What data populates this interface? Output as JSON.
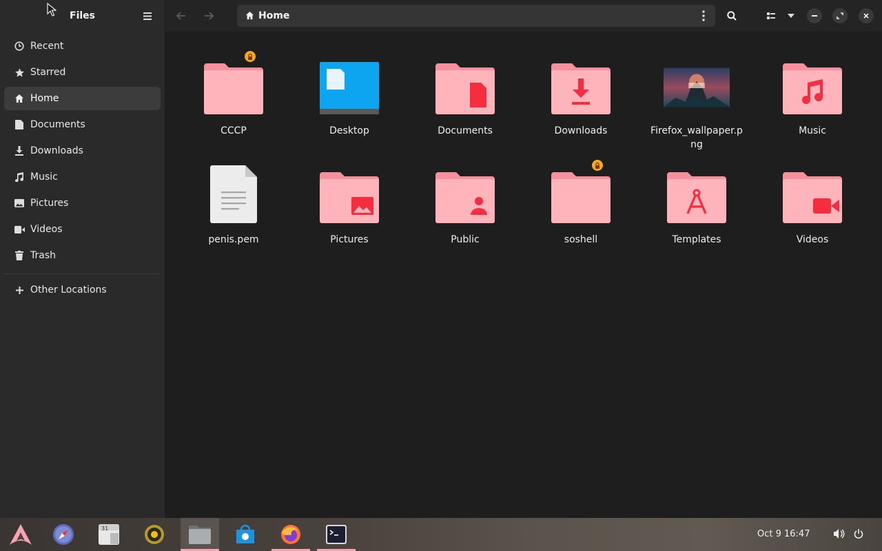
{
  "sidebar": {
    "title": "Files",
    "items": [
      {
        "label": "Recent",
        "icon": "clock-icon"
      },
      {
        "label": "Starred",
        "icon": "star-icon"
      },
      {
        "label": "Home",
        "icon": "home-icon",
        "active": true
      },
      {
        "label": "Documents",
        "icon": "document-icon"
      },
      {
        "label": "Downloads",
        "icon": "download-icon"
      },
      {
        "label": "Music",
        "icon": "music-icon"
      },
      {
        "label": "Pictures",
        "icon": "picture-icon"
      },
      {
        "label": "Videos",
        "icon": "video-icon"
      },
      {
        "label": "Trash",
        "icon": "trash-icon"
      }
    ],
    "other_locations": "Other Locations"
  },
  "header": {
    "path_label": "Home"
  },
  "files": [
    {
      "name": "CCCP",
      "icon": "folder-icon",
      "locked": true
    },
    {
      "name": "Desktop",
      "icon": "desktop-folder-icon"
    },
    {
      "name": "Documents",
      "icon": "documents-folder-icon"
    },
    {
      "name": "Downloads",
      "icon": "downloads-folder-icon"
    },
    {
      "name": "Firefox_wallpaper.png",
      "icon": "image-thumbnail-icon"
    },
    {
      "name": "Music",
      "icon": "music-folder-icon"
    },
    {
      "name": "penis.pem",
      "icon": "text-file-icon"
    },
    {
      "name": "Pictures",
      "icon": "pictures-folder-icon"
    },
    {
      "name": "Public",
      "icon": "public-folder-icon"
    },
    {
      "name": "soshell",
      "icon": "folder-icon",
      "locked": true
    },
    {
      "name": "Templates",
      "icon": "templates-folder-icon"
    },
    {
      "name": "Videos",
      "icon": "videos-folder-icon"
    }
  ],
  "taskbar": {
    "apps": [
      "arch-launcher-icon",
      "compass-browser-icon",
      "calendar-icon",
      "rhythmbox-icon",
      "files-icon",
      "software-store-icon",
      "firefox-icon",
      "terminal-icon"
    ],
    "calendar_day": "31",
    "clock": "Oct 9  16:47"
  },
  "colors": {
    "folder": "#ffb3bb",
    "folder_tab": "#f7909d",
    "folder_emblem": "#f52d3f",
    "desktop_folder": "#0ea5f0",
    "lock_badge": "#f6a623",
    "taskbar_indicator": "#f7a3b1"
  }
}
